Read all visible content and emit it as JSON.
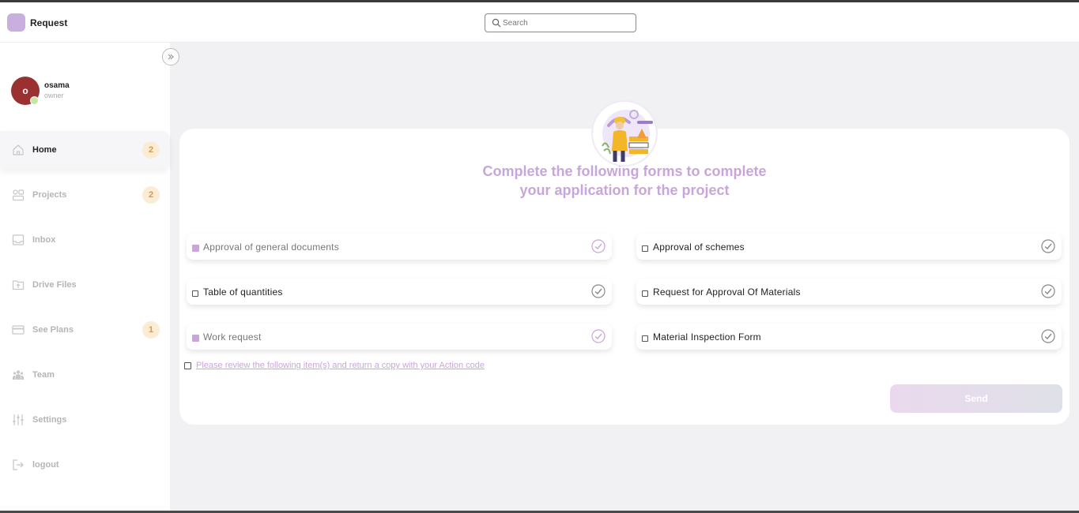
{
  "app": {
    "title": "Request",
    "brand_color": "#c9aee0"
  },
  "search": {
    "placeholder": "Search"
  },
  "user": {
    "initial": "o",
    "name": "osama",
    "role": "owner",
    "avatar_color": "#9b3030",
    "status_color": "#c6e6a3"
  },
  "sidebar": {
    "items": [
      {
        "label": "Home",
        "icon": "home-icon",
        "badge": "2",
        "active": true
      },
      {
        "label": "Projects",
        "icon": "projects-icon",
        "badge": "2"
      },
      {
        "label": "Inbox",
        "icon": "inbox-icon"
      },
      {
        "label": "Drive Files",
        "icon": "folder-upload-icon"
      },
      {
        "label": "See Plans",
        "icon": "card-icon",
        "badge": "1"
      },
      {
        "label": "Team",
        "icon": "team-icon"
      },
      {
        "label": "Settings",
        "icon": "sliders-icon"
      },
      {
        "label": "logout",
        "icon": "logout-icon"
      }
    ]
  },
  "main": {
    "headline_line1": "Complete the following forms to complete",
    "headline_line2": "your application for the project",
    "accent_color": "#c9a6d9",
    "forms": [
      {
        "label": "Approval of general documents",
        "checked": true
      },
      {
        "label": "Approval of schemes",
        "checked": false
      },
      {
        "label": "Table of quantities",
        "checked": false
      },
      {
        "label": "Request for Approval Of Materials",
        "checked": false
      },
      {
        "label": "Work request",
        "checked": true
      },
      {
        "label": "Material Inspection Form",
        "checked": false
      }
    ],
    "review_link": "Please review the following item(s) and return a copy with your Action code",
    "send_label": "Send"
  }
}
